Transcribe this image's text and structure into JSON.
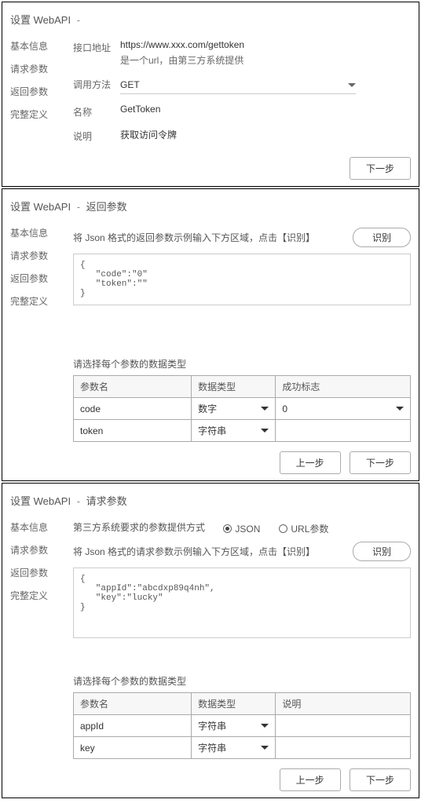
{
  "panel1": {
    "title_a": "设置 WebAPI",
    "dash": "-",
    "sidebar": [
      "基本信息",
      "请求参数",
      "返回参数",
      "完整定义"
    ],
    "rows": {
      "addr_label": "接口地址",
      "addr_value": "https://www.xxx.com/gettoken",
      "addr_hint": "是一个url，由第三方系统提供",
      "method_label": "调用方法",
      "method_value": "GET",
      "name_label": "名称",
      "name_value": "GetToken",
      "desc_label": "说明",
      "desc_value": "获取访问令牌"
    },
    "next": "下一步"
  },
  "panel2": {
    "title_a": "设置 WebAPI",
    "dash": "-",
    "title_b": "返回参数",
    "sidebar": [
      "基本信息",
      "请求参数",
      "返回参数",
      "完整定义"
    ],
    "instruction": "将 Json 格式的返回参数示例输入下方区域，点击【识别】",
    "recognize": "识别",
    "sample": "{\n   \"code\":\"0\"\n   \"token\":\"\"\n}",
    "instruction2": "请选择每个参数的数据类型",
    "headers": {
      "name": "参数名",
      "type": "数据类型",
      "flag": "成功标志"
    },
    "rows": [
      {
        "name": "code",
        "type": "数字",
        "flag": "0"
      },
      {
        "name": "token",
        "type": "字符串",
        "flag": ""
      }
    ],
    "prev": "上一步",
    "next": "下一步"
  },
  "panel3": {
    "title_a": "设置 WebAPI",
    "dash": "-",
    "title_b": "请求参数",
    "sidebar": [
      "基本信息",
      "请求参数",
      "返回参数",
      "完整定义"
    ],
    "mode_label": "第三方系统要求的参数提供方式",
    "mode_options": {
      "json": "JSON",
      "url": "URL参数"
    },
    "instruction": "将 Json 格式的请求参数示例输入下方区域，点击【识别】",
    "recognize": "识别",
    "sample": "{\n   \"appId\":\"abcdxp89q4nh\",\n   \"key\":\"lucky\"\n}",
    "instruction2": "请选择每个参数的数据类型",
    "headers": {
      "name": "参数名",
      "type": "数据类型",
      "desc": "说明"
    },
    "rows": [
      {
        "name": "appId",
        "type": "字符串",
        "desc": ""
      },
      {
        "name": "key",
        "type": "字符串",
        "desc": ""
      }
    ],
    "prev": "上一步",
    "next": "下一步"
  }
}
